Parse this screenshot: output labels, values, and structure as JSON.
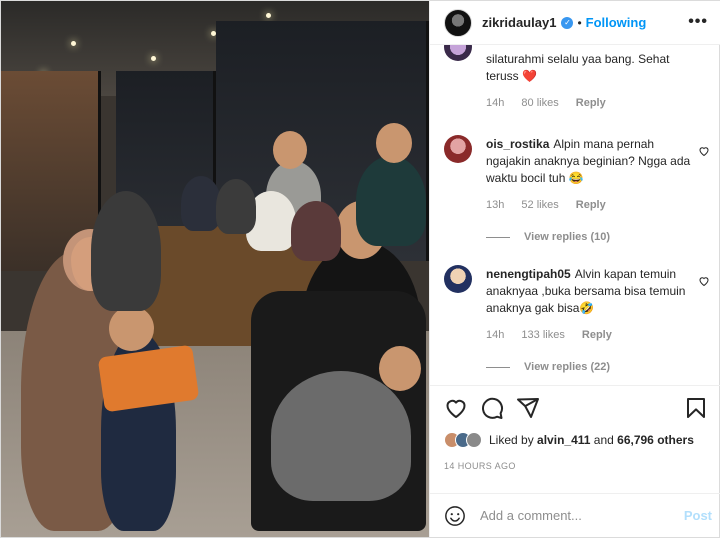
{
  "header": {
    "username": "zikridaulay1",
    "verified_mark": "✓",
    "separator": "•",
    "follow_label": "Following",
    "more_label": "•••"
  },
  "comments": [
    {
      "username": "",
      "text": "silaturahmi selalu yaa bang. Sehat teruss ❤️",
      "time": "14h",
      "likes": "80 likes",
      "reply_label": "Reply",
      "view_replies": ""
    },
    {
      "username": "ois_rostika",
      "text": "Alpin mana pernah ngajakin anaknya beginian? Ngga ada waktu bocil tuh 😂",
      "time": "13h",
      "likes": "52 likes",
      "reply_label": "Reply",
      "view_replies": "View replies (10)"
    },
    {
      "username": "nenengtipah05",
      "text": "Alvin kapan temuin anaknyaa ,buka bersama bisa temuin anaknya gak bisa🤣",
      "time": "14h",
      "likes": "133 likes",
      "reply_label": "Reply",
      "view_replies": "View replies (22)"
    }
  ],
  "actions": {
    "like_icon": "heart-icon",
    "comment_icon": "comment-icon",
    "share_icon": "share-icon",
    "save_icon": "bookmark-icon"
  },
  "likes": {
    "prefix": "Liked by",
    "user": "alvin_411",
    "middle": "and",
    "others": "66,796 others"
  },
  "timestamp": "14 HOURS AGO",
  "add_comment": {
    "placeholder": "Add a comment...",
    "post_label": "Post"
  },
  "colors": {
    "accent": "#0095f6",
    "post_disabled": "#b2dffc",
    "meta_text": "#8e8e8e"
  }
}
